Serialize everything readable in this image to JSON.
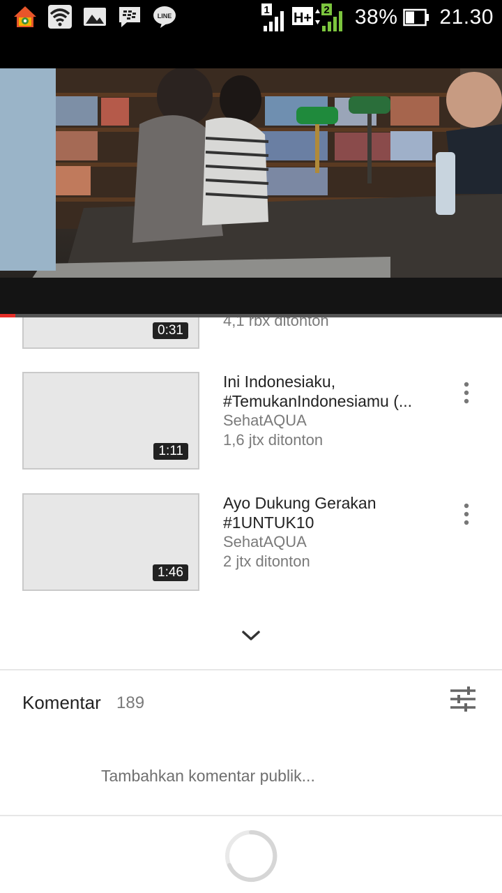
{
  "status_bar": {
    "battery_percent": "38%",
    "time": "21.30",
    "network_type": "H+",
    "sim1_label": "1",
    "sim2_label": "2",
    "icons": [
      "home-icon",
      "wifi-icon",
      "gallery-icon",
      "bbm-icon",
      "line-icon"
    ]
  },
  "video": {
    "progress_fraction": 0.03,
    "accent_color": "#e52d27"
  },
  "related_videos": [
    {
      "duration": "0:31",
      "views": "4,1 rbx ditonton"
    },
    {
      "title_line1": "Ini Indonesiaku,",
      "title_line2": "#TemukanIndonesiamu (...",
      "channel": "SehatAQUA",
      "views": "1,6 jtx ditonton",
      "duration": "1:11"
    },
    {
      "title_line1": "Ayo Dukung Gerakan",
      "title_line2": "#1UNTUK10",
      "channel": "SehatAQUA",
      "views": "2 jtx ditonton",
      "duration": "1:46"
    }
  ],
  "comments": {
    "label": "Komentar",
    "count": "189",
    "add_placeholder": "Tambahkan komentar publik..."
  }
}
